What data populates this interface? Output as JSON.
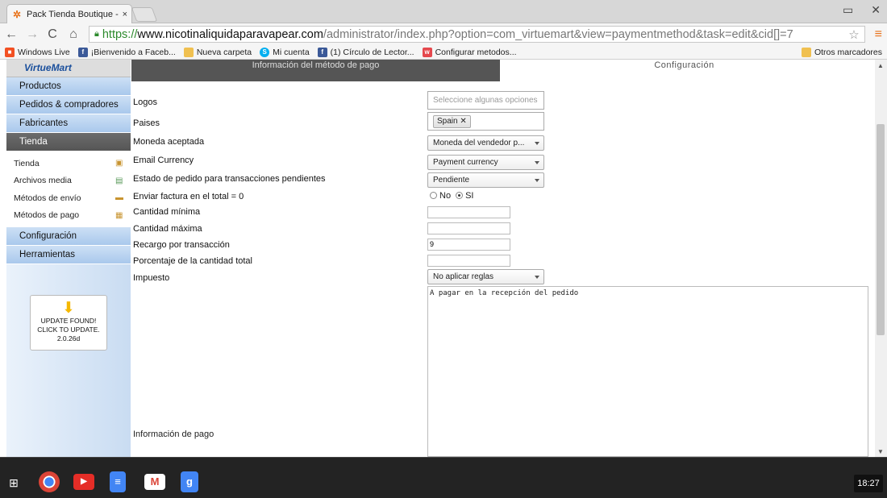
{
  "browser": {
    "tab_title": "Pack Tienda Boutique - A",
    "tab_close": "×",
    "url_scheme": "https://",
    "url_host": "www.nicotinaliquidaparavapear.com",
    "url_path": "/administrator/index.php?option=com_virtuemart&view=paymentmethod&task=edit&cid[]=7",
    "bookmarks": [
      {
        "label": "Windows Live",
        "icon": "windows-icon",
        "color": "#f25022"
      },
      {
        "label": "¡Bienvenido a Faceb...",
        "icon": "facebook-icon",
        "color": "#3b5998"
      },
      {
        "label": "Nueva carpeta",
        "icon": "folder-icon",
        "color": "#f0c050"
      },
      {
        "label": "Mi cuenta",
        "icon": "skype-icon",
        "color": "#00aff0"
      },
      {
        "label": "(1) Círculo de Lector...",
        "icon": "facebook-icon",
        "color": "#3b5998"
      },
      {
        "label": "Configurar metodos...",
        "icon": "wallapop-icon",
        "color": "#e5484d"
      }
    ],
    "other_bookmarks": "Otros marcadores"
  },
  "sidebar": {
    "logo": "VirtueMart",
    "menu_top": [
      "Productos",
      "Pedidos & compradores",
      "Fabricantes"
    ],
    "active": "Tienda",
    "submenu": [
      "Tienda",
      "Archivos media",
      "Métodos de envío",
      "Métodos de pago"
    ],
    "menu_bottom": [
      "Configuración",
      "Herramientas"
    ],
    "update_line1": "UPDATE FOUND!",
    "update_line2": "CLICK TO UPDATE.",
    "update_version": "2.0.26d"
  },
  "tabs": {
    "info": "Información del método de pago",
    "config": "Configuración"
  },
  "form": {
    "logos_label": "Logos",
    "logos_placeholder": "Seleccione algunas opciones",
    "paises_label": "Paises",
    "paises_tag": "Spain",
    "moneda_label": "Moneda aceptada",
    "moneda_value": "Moneda del vendedor p...",
    "email_currency_label": "Email Currency",
    "email_currency_value": "Payment currency",
    "estado_label": "Estado de pedido para transacciones pendientes",
    "estado_value": "Pendiente",
    "factura_label": "Enviar factura en el total = 0",
    "factura_no": "No",
    "factura_si": "SI",
    "cant_min_label": "Cantidad mínima",
    "cant_min_value": "",
    "cant_max_label": "Cantidad máxima",
    "cant_max_value": "",
    "recargo_label": "Recargo por transacción",
    "recargo_value": "9",
    "porcentaje_label": "Porcentaje de la cantidad total",
    "porcentaje_value": "",
    "impuesto_label": "Impuesto",
    "impuesto_value": "No aplicar reglas",
    "info_pago_label": "Información de pago",
    "info_pago_text": "A pagar en la recepción del pedido"
  },
  "taskbar": {
    "clock": "18:27"
  }
}
